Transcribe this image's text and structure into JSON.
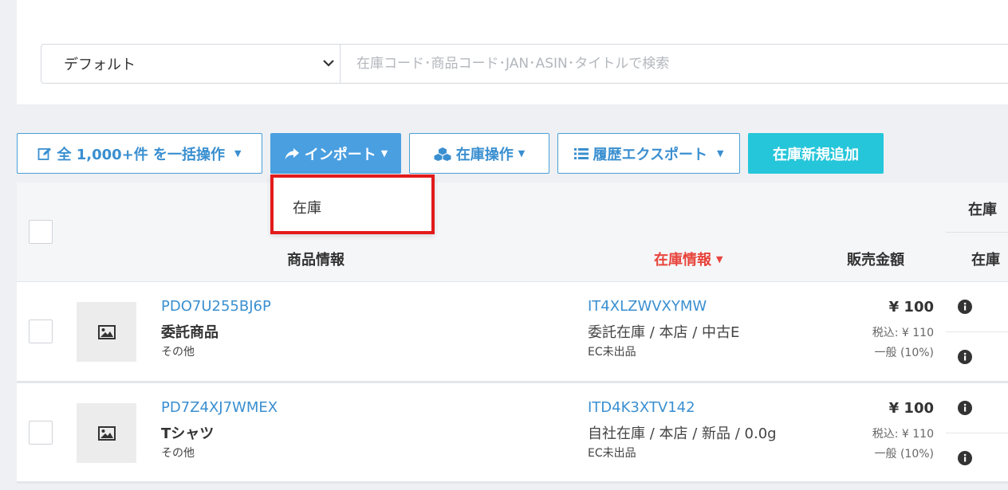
{
  "search": {
    "select_value": "デフォルト",
    "placeholder": "在庫コード･商品コード･JAN･ASIN･タイトルで検索"
  },
  "toolbar": {
    "bulk_label": "全 1,000+件 を一括操作",
    "import_label": "インポート",
    "stock_ops_label": "在庫操作",
    "export_label": "履歴エクスポート",
    "new_label": "在庫新規追加"
  },
  "import_menu": {
    "items": [
      {
        "label": "在庫"
      }
    ]
  },
  "table": {
    "headers": {
      "product": "商品情報",
      "stock": "在庫情報",
      "price": "販売金額",
      "stock_group": "在庫",
      "stock_sub": "在庫"
    },
    "rows": [
      {
        "product_code": "PDO7U255BJ6P",
        "product_name": "委託商品",
        "category": "その他",
        "stock_code": "IT4XLZWVXYMW",
        "stock_desc": "委託在庫 / 本店 / 中古E",
        "ec_status": "EC未出品",
        "price": "¥ 100",
        "tax_incl": "税込: ¥ 110",
        "tax_type": "一般 (10%)"
      },
      {
        "product_code": "PD7Z4XJ7WMEX",
        "product_name": "Tシャツ",
        "category": "その他",
        "stock_code": "ITD4K3XTV142",
        "stock_desc": "自社在庫 / 本店 / 新品 / 0.0g",
        "ec_status": "EC未出品",
        "price": "¥ 100",
        "tax_incl": "税込: ¥ 110",
        "tax_type": "一般 (10%)"
      }
    ]
  },
  "colors": {
    "primary": "#4a9fe0",
    "accent": "#26c6da",
    "sort_active": "#e8453c",
    "highlight": "#e21b1b"
  }
}
